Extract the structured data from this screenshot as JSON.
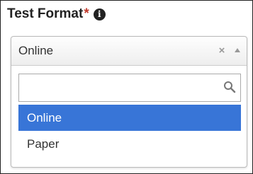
{
  "field": {
    "label": "Test Format",
    "required_mark": "*",
    "info_icon_glyph": "i",
    "info_icon": "info-circle-icon"
  },
  "select": {
    "selected_value": "Online",
    "clear_icon_glyph": "×",
    "clear_icon": "close-icon",
    "caret_icon": "caret-up-icon",
    "search": {
      "value": "",
      "placeholder": "",
      "icon": "search-icon"
    },
    "options": [
      {
        "label": "Online",
        "highlighted": true
      },
      {
        "label": "Paper",
        "highlighted": false
      }
    ]
  },
  "colors": {
    "highlight": "#3875d7",
    "required": "#c0392b",
    "text": "#333333"
  }
}
